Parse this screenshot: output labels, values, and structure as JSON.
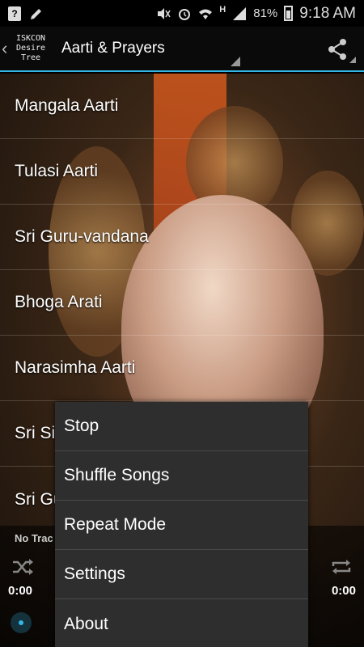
{
  "status_bar": {
    "battery": "81%",
    "time": "9:18 AM",
    "icons": [
      "help-box-icon",
      "pencil-icon",
      "mute-icon",
      "alarm-icon",
      "wifi-icon",
      "h-network-icon",
      "signal-icon",
      "battery-icon"
    ],
    "network_letter": "H",
    "help_letter": "?"
  },
  "action_bar": {
    "logo_lines": [
      "ISKCON",
      "Desire",
      "Tree"
    ],
    "title": "Aarti & Prayers",
    "share_icon": "share-icon",
    "accent": "#33b5e5"
  },
  "list": {
    "items": [
      {
        "label": "Mangala Aarti"
      },
      {
        "label": "Tulasi Aarti"
      },
      {
        "label": "Sri Guru-vandana"
      },
      {
        "label": "Bhoga Arati"
      },
      {
        "label": "Narasimha Aarti"
      },
      {
        "label": "Sri Si"
      },
      {
        "label": "Sri Gu"
      }
    ]
  },
  "player": {
    "track": "No Trac",
    "time_elapsed": "0:00",
    "time_total": "0:00",
    "progress": 0
  },
  "menu": {
    "items": [
      {
        "label": "Stop"
      },
      {
        "label": "Shuffle Songs"
      },
      {
        "label": "Repeat Mode"
      },
      {
        "label": "Settings"
      },
      {
        "label": "About"
      }
    ]
  }
}
